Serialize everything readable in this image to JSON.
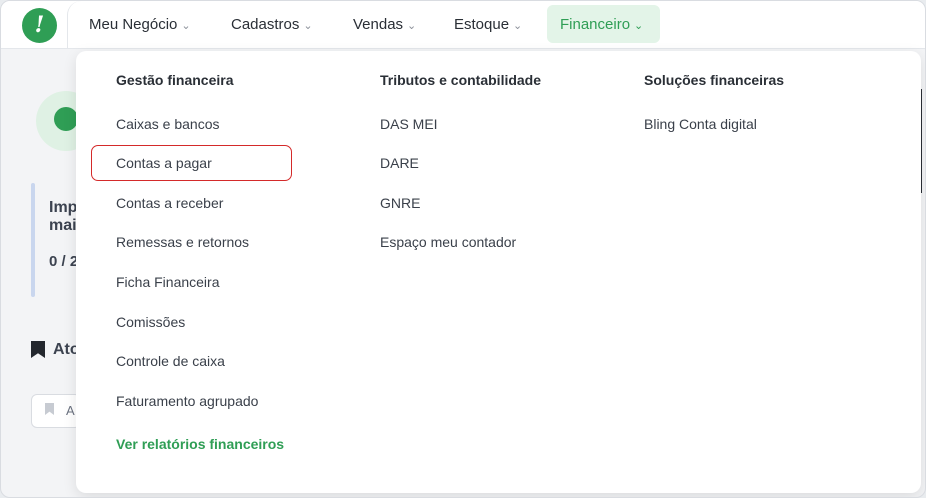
{
  "navbar": {
    "logo_glyph": "!",
    "items": [
      {
        "label": "Meu Negócio"
      },
      {
        "label": "Cadastros"
      },
      {
        "label": "Vendas"
      },
      {
        "label": "Estoque"
      },
      {
        "label": "Financeiro",
        "active": true
      }
    ],
    "chevron": "⌄"
  },
  "background": {
    "card_text_1": "Imp",
    "card_text_2": "mai",
    "counter": "0 / 2",
    "section_title": "Ato",
    "pill_text": "A"
  },
  "dropdown": {
    "columns": [
      {
        "title": "Gestão financeira",
        "items": [
          "Caixas e bancos",
          "Contas a pagar",
          "Contas a receber",
          "Remessas e retornos",
          "Ficha Financeira",
          "Comissões",
          "Controle de caixa",
          "Faturamento agrupado"
        ],
        "report_link": "Ver relatórios financeiros"
      },
      {
        "title": "Tributos e contabilidade",
        "items": [
          "DAS MEI",
          "DARE",
          "GNRE",
          "Espaço meu contador"
        ]
      },
      {
        "title": "Soluções financeiras",
        "items": [
          "Bling Conta digital"
        ]
      }
    ],
    "highlighted_item": "Contas a pagar"
  },
  "colors": {
    "brand_green": "#2f9e55",
    "active_bg": "#e3f4e8",
    "highlight_red": "#d42a2a"
  }
}
